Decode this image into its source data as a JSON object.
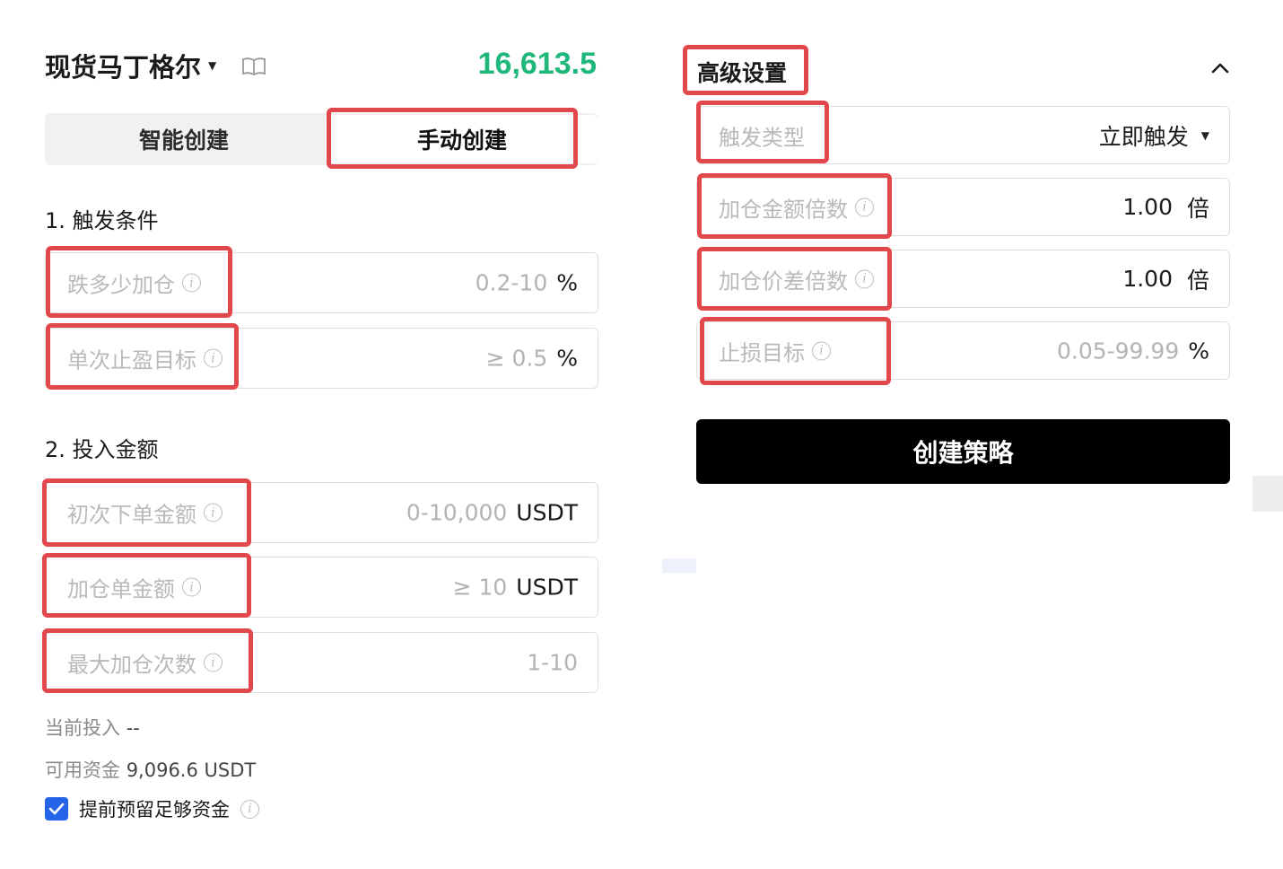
{
  "header": {
    "title": "现货马丁格尔",
    "price": "16,613.5"
  },
  "tabs": {
    "smart": "智能创建",
    "manual": "手动创建"
  },
  "section1": {
    "label": "1. 触发条件",
    "drop_add": {
      "label": "跌多少加仓",
      "placeholder": "0.2-10",
      "unit": "%"
    },
    "take_profit": {
      "label": "单次止盈目标",
      "placeholder": "≥ 0.5",
      "unit": "%"
    }
  },
  "section2": {
    "label": "2. 投入金额",
    "initial_order": {
      "label": "初次下单金额",
      "placeholder": "0-10,000",
      "unit": "USDT"
    },
    "add_order": {
      "label": "加仓单金额",
      "placeholder": "≥ 10",
      "unit": "USDT"
    },
    "max_adds": {
      "label": "最大加仓次数",
      "placeholder": "1-10"
    }
  },
  "summary": {
    "current_invest_label": "当前投入",
    "current_invest_value": "--",
    "available_label": "可用资金",
    "available_value": "9,096.6 USDT",
    "reserve_label": "提前预留足够资金",
    "reserve_checked": true
  },
  "advanced": {
    "title": "高级设置",
    "trigger_type": {
      "label": "触发类型",
      "value": "立即触发"
    },
    "amount_multiplier": {
      "label": "加仓金额倍数",
      "value": "1.00",
      "unit": "倍"
    },
    "spread_multiplier": {
      "label": "加仓价差倍数",
      "value": "1.00",
      "unit": "倍"
    },
    "stop_loss": {
      "label": "止损目标",
      "placeholder": "0.05-99.99",
      "unit": "%"
    }
  },
  "actions": {
    "create": "创建策略"
  },
  "colors": {
    "price_green": "#1fb87a",
    "highlight_red": "#e2474b",
    "checkbox_blue": "#2364e8",
    "button_black": "#000000"
  }
}
